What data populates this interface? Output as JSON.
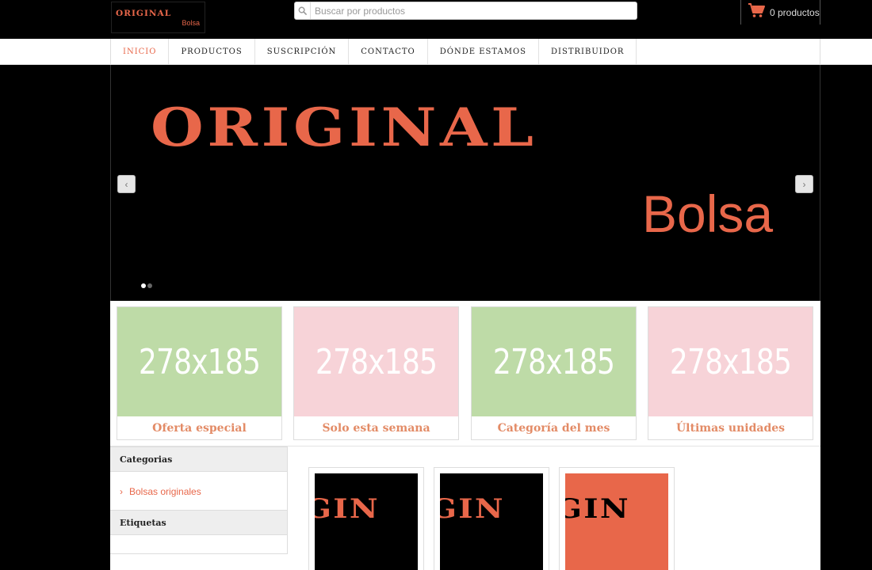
{
  "brand": {
    "logo_title": "ORIGINAL",
    "logo_sub": "Bolsa",
    "accent_color": "#e8674a"
  },
  "search": {
    "placeholder": "Buscar por productos",
    "icon": "search-icon"
  },
  "cart": {
    "icon": "cart-icon",
    "label": "0 productos"
  },
  "nav": {
    "items": [
      {
        "label": "INICIO",
        "active": true
      },
      {
        "label": "PRODUCTOS",
        "active": false
      },
      {
        "label": "SUSCRIPCIÓN",
        "active": false
      },
      {
        "label": "CONTACTO",
        "active": false
      },
      {
        "label": "DÓNDE ESTAMOS",
        "active": false
      },
      {
        "label": "DISTRIBUIDOR",
        "active": false
      }
    ]
  },
  "hero": {
    "title": "ORIGINAL",
    "subtitle": "Bolsa",
    "prev_icon": "chevron-left-icon",
    "next_icon": "chevron-right-icon",
    "prev_glyph": "‹",
    "next_glyph": "›",
    "slide_count": 2,
    "active_slide": 1
  },
  "promos": [
    {
      "image_text": "278x185",
      "label": "Oferta especial",
      "color": "#bedba7"
    },
    {
      "image_text": "278x185",
      "label": "Solo esta semana",
      "color": "#f7d3d8"
    },
    {
      "image_text": "278x185",
      "label": "Categoría del mes",
      "color": "#bedba7"
    },
    {
      "image_text": "278x185",
      "label": "Últimas unidades",
      "color": "#f7d3d8"
    }
  ],
  "sidebar": {
    "categories_heading": "Categorias",
    "category_link": "Bolsas originales",
    "chevron_glyph": "›",
    "tags_heading": "Etiquetas"
  },
  "products": [
    {
      "image_text": "IGIN",
      "background": "#000000",
      "text_color": "#e8674a"
    },
    {
      "image_text": "IGIN",
      "background": "#000000",
      "text_color": "#e8674a"
    },
    {
      "image_text": "IGIN",
      "background": "#e8674a",
      "text_color": "#000000"
    }
  ]
}
